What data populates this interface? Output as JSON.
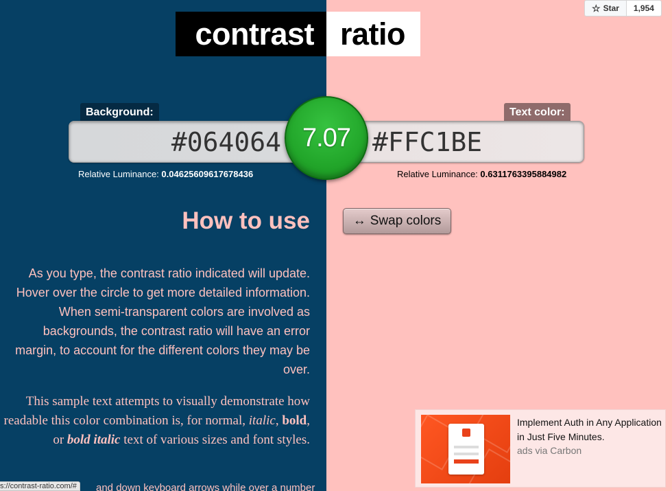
{
  "title": {
    "left": "contrast",
    "right": "ratio"
  },
  "github": {
    "star_label": "Star",
    "count": "1,954",
    "icon": "star-icon"
  },
  "background": {
    "label": "Background:",
    "value": "#064064",
    "luminance_label": "Relative Luminance:",
    "luminance": "0.04625609617678436"
  },
  "text_color": {
    "label": "Text color:",
    "value": "#FFC1BE",
    "luminance_label": "Relative Luminance:",
    "luminance": "0.6311763395884982"
  },
  "ratio": "7.07",
  "swap": {
    "arrow": "↔",
    "label": "Swap colors"
  },
  "how_to_use": {
    "heading": "How to use",
    "paragraph": "As you type, the contrast ratio indicated will update. Hover over the circle to get more detailed information. When semi-transparent colors are involved as backgrounds, the contrast ratio will have an error margin, to account for the different colors they may be over.",
    "sample_a": "This sample text attempts to visually demonstrate how readable this color combination is, for normal, ",
    "sample_italic": "italic",
    "sample_b": ", ",
    "sample_bold": "bold",
    "sample_c": ", or ",
    "sample_bold_italic": "bold italic",
    "sample_d": " text of various sizes and font styles.",
    "cut_text": "and down keyboard arrows while over a number"
  },
  "ad": {
    "title": "Implement Auth in Any Application in Just Five Minutes.",
    "via": "ads via Carbon"
  },
  "status_url": "s://contrast-ratio.com/#",
  "colors": {
    "background": "#064064",
    "text": "#FFC1BE",
    "ratio_green": "#22a62a"
  }
}
